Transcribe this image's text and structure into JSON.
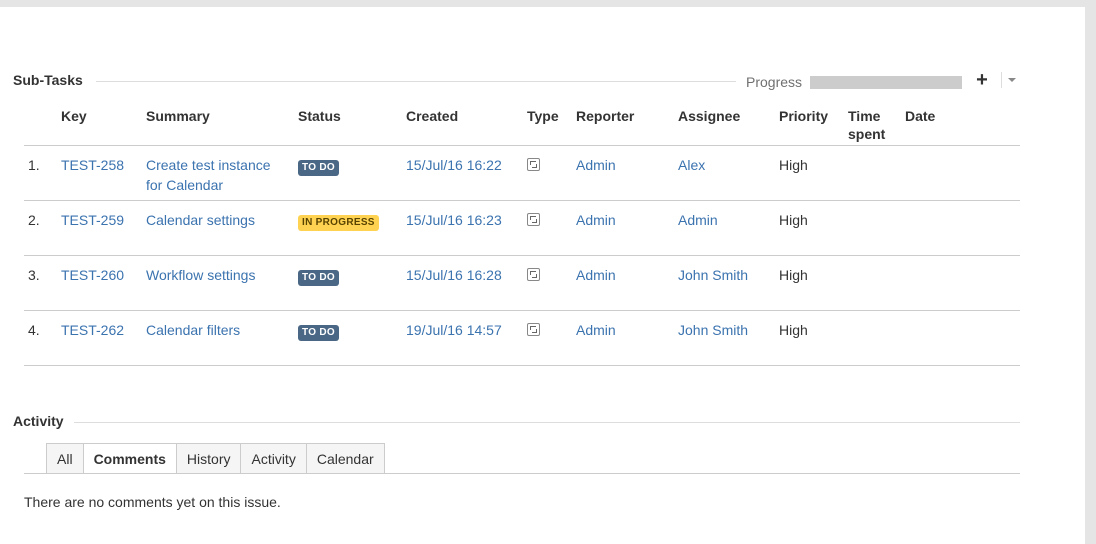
{
  "subtasks": {
    "title": "Sub-Tasks",
    "progress_label": "Progress",
    "progress_value": 0,
    "add_label": "+",
    "columns": [
      "Key",
      "Summary",
      "Status",
      "Created",
      "Type",
      "Reporter",
      "Assignee",
      "Priority",
      "Time spent",
      "Date"
    ],
    "rows": [
      {
        "num": "1.",
        "key": "TEST-258",
        "summary": "Create test instance for Calendar",
        "status": "TO DO",
        "created": "15/Jul/16 16:22",
        "type_icon": "subtask-icon",
        "reporter": "Admin",
        "assignee": "Alex",
        "priority": "High"
      },
      {
        "num": "2.",
        "key": "TEST-259",
        "summary": "Calendar settings",
        "status": "IN PROGRESS",
        "created": "15/Jul/16 16:23",
        "type_icon": "subtask-icon",
        "reporter": "Admin",
        "assignee": "Admin",
        "priority": "High"
      },
      {
        "num": "3.",
        "key": "TEST-260",
        "summary": "Workflow settings",
        "status": "TO DO",
        "created": "15/Jul/16 16:28",
        "type_icon": "subtask-icon",
        "reporter": "Admin",
        "assignee": "John Smith",
        "priority": "High"
      },
      {
        "num": "4.",
        "key": "TEST-262",
        "summary": "Calendar filters",
        "status": "TO DO",
        "created": "19/Jul/16 14:57",
        "type_icon": "subtask-icon",
        "reporter": "Admin",
        "assignee": "John Smith",
        "priority": "High"
      }
    ]
  },
  "activity": {
    "title": "Activity",
    "tabs": [
      "All",
      "Comments",
      "History",
      "Activity",
      "Calendar"
    ],
    "active_tab": "Comments",
    "empty_message": "There are no comments yet on this issue."
  },
  "colors": {
    "link": "#3b73af",
    "todo_lozenge": "#4a6785",
    "in_progress_lozenge": "#ffd351"
  }
}
